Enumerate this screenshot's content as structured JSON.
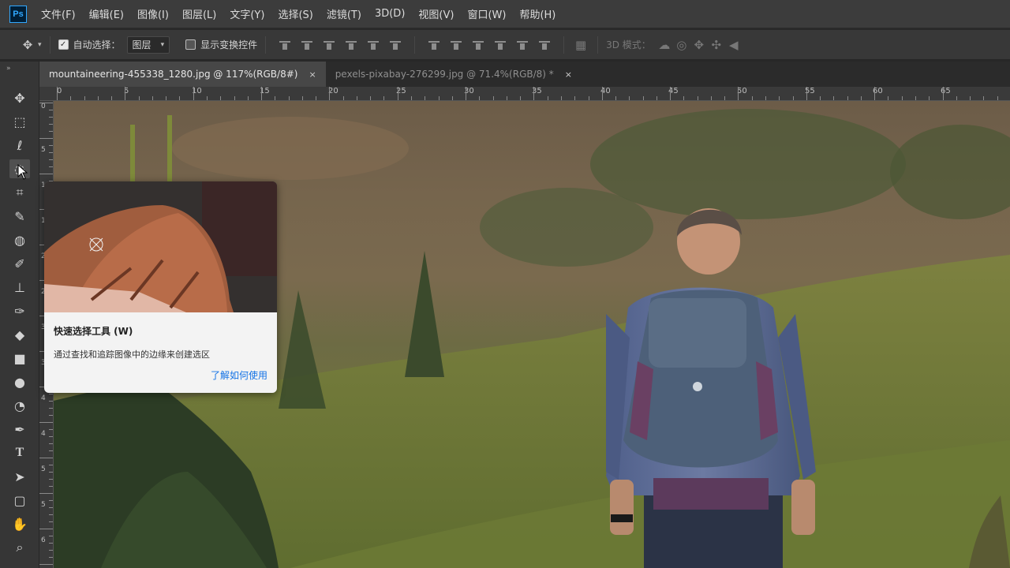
{
  "app": {
    "logo": "Ps"
  },
  "menu": [
    "文件(F)",
    "编辑(E)",
    "图像(I)",
    "图层(L)",
    "文字(Y)",
    "选择(S)",
    "滤镜(T)",
    "3D(D)",
    "视图(V)",
    "窗口(W)",
    "帮助(H)"
  ],
  "options": {
    "auto_select_label": "自动选择：",
    "auto_select_checked": true,
    "layer_select": "图层",
    "show_transform_label": "显示变换控件",
    "show_transform_checked": false,
    "mode_3d_label": "3D 模式："
  },
  "tabs": [
    {
      "label": "mountaineering-455338_1280.jpg @ 117%(RGB/8#)",
      "close": "×",
      "active": true
    },
    {
      "label": "pexels-pixabay-276299.jpg @ 71.4%(RGB/8) *",
      "close": "×",
      "active": false
    }
  ],
  "ruler": {
    "top_labels": [
      "0",
      "5",
      "10",
      "15",
      "20",
      "25",
      "30",
      "35",
      "40",
      "45",
      "50",
      "55",
      "60",
      "65"
    ],
    "left_labels": [
      "0",
      "5",
      "1",
      "1",
      "2",
      "2",
      "3",
      "3",
      "4",
      "4",
      "5",
      "5",
      "6"
    ]
  },
  "tools": [
    {
      "name": "move-tool",
      "glyph": "✥"
    },
    {
      "name": "marquee-tool",
      "glyph": "⬚"
    },
    {
      "name": "lasso-tool",
      "glyph": "ℓ"
    },
    {
      "name": "quick-selection-tool",
      "glyph": "◌"
    },
    {
      "name": "crop-tool",
      "glyph": "⌗"
    },
    {
      "name": "eyedropper-tool",
      "glyph": "✎"
    },
    {
      "name": "healing-brush-tool",
      "glyph": "◍"
    },
    {
      "name": "brush-tool",
      "glyph": "✐"
    },
    {
      "name": "stamp-tool",
      "glyph": "⊥"
    },
    {
      "name": "history-brush-tool",
      "glyph": "✑"
    },
    {
      "name": "eraser-tool",
      "glyph": "◆"
    },
    {
      "name": "gradient-tool",
      "glyph": "■"
    },
    {
      "name": "blur-tool",
      "glyph": "●"
    },
    {
      "name": "dodge-tool",
      "glyph": "◔"
    },
    {
      "name": "pen-tool",
      "glyph": "✒"
    },
    {
      "name": "type-tool",
      "glyph": "T"
    },
    {
      "name": "path-selection-tool",
      "glyph": "➤"
    },
    {
      "name": "shape-tool",
      "glyph": "▢"
    },
    {
      "name": "hand-tool",
      "glyph": "✋"
    },
    {
      "name": "zoom-tool",
      "glyph": "⌕"
    }
  ],
  "tooltip": {
    "title": "快速选择工具 (W)",
    "description": "通过查找和追踪图像中的边缘来创建选区",
    "link": "了解如何使用"
  }
}
